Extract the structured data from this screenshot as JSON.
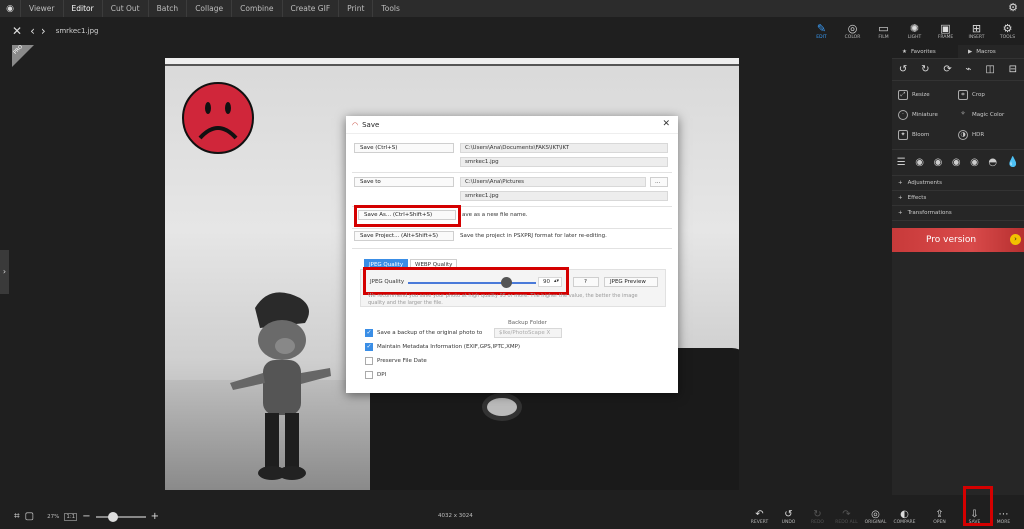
{
  "menu": {
    "items": [
      "Viewer",
      "Editor",
      "Cut Out",
      "Batch",
      "Collage",
      "Combine",
      "Create GIF",
      "Print",
      "Tools"
    ],
    "active": "Editor"
  },
  "file": {
    "name": "smrkec1.jpg"
  },
  "tools": [
    {
      "label": "EDIT",
      "glyph": "✎"
    },
    {
      "label": "COLOR",
      "glyph": "◎"
    },
    {
      "label": "FILM",
      "glyph": "▭"
    },
    {
      "label": "LIGHT",
      "glyph": "✺"
    },
    {
      "label": "FRAME",
      "glyph": "▣"
    },
    {
      "label": "INSERT",
      "glyph": "⊞"
    },
    {
      "label": "TOOLS",
      "glyph": "⚙"
    }
  ],
  "right_panel": {
    "tabs": [
      "Favorites",
      "Macros"
    ],
    "tool_items": [
      "Resize",
      "Crop",
      "Miniature",
      "Magic Color",
      "Bloom",
      "HDR"
    ],
    "sections": [
      "Adjustments",
      "Effects",
      "Transformations"
    ],
    "pro_banner": "Pro version"
  },
  "corner_badge": "PRO",
  "dialog": {
    "title": "Save",
    "save_label": "Save   (Ctrl+S)",
    "save_path": "C:\\Users\\Ana\\Documents\\FAKS\\IKT\\IKT",
    "save_file": "smrkec1.jpg",
    "save_to_label": "Save to",
    "save_to_path": "C:\\Users\\Ana\\Pictures",
    "save_to_browse": "...",
    "save_to_file": "smrkec1.jpg",
    "save_as_label": "Save As...   (Ctrl+Shift+S)",
    "save_as_desc": "ave as a new file name.",
    "save_project_label": "Save Project...   (Alt+Shift+S)",
    "save_project_desc": "Save the project in PSXPRJ format for later re-editing.",
    "tab_jpeg": "JPEG Quality",
    "tab_webp": "WEBP Quality",
    "jpeg_quality_label": "JPEG Quality",
    "jpeg_quality_value": "90",
    "jpeg_quality_fraction": 0.9,
    "help_button": "?",
    "preview_button": "JPEG Preview",
    "quality_note_1": "We recommend you save your photo at high quality 95 or more. The higher the value, the better the image",
    "quality_note_2": "quality and the larger the file.",
    "backup_folder_label": "Backup Folder",
    "backup_folder_value": "$Ike/PhotoScape X",
    "options": [
      {
        "label": "Save a backup of the original photo to",
        "checked": true
      },
      {
        "label": "Maintain Metadata Information (EXIF,GPS,IPTC,XMP)",
        "checked": true
      },
      {
        "label": "Preserve File Date",
        "checked": false
      },
      {
        "label": "DPI",
        "checked": false
      }
    ]
  },
  "bottom": {
    "zoom": "27%",
    "zoom_fit": "1:1",
    "zoom_fraction": 0.27,
    "image_size": "4032 x 3024",
    "actions": [
      {
        "label": "REVERT",
        "glyph": "↶",
        "enabled": true
      },
      {
        "label": "UNDO",
        "glyph": "↺",
        "enabled": true
      },
      {
        "label": "REDO",
        "glyph": "↻",
        "enabled": false
      },
      {
        "label": "REDO ALL",
        "glyph": "↷",
        "enabled": false
      },
      {
        "label": "ORIGINAL",
        "glyph": "◎",
        "enabled": true
      },
      {
        "label": "COMPARE",
        "glyph": "◐",
        "enabled": true
      },
      {
        "label": "OPEN",
        "glyph": "⇪",
        "enabled": true
      },
      {
        "label": "SAVE",
        "glyph": "⇩",
        "enabled": true
      },
      {
        "label": "MORE",
        "glyph": "⋯",
        "enabled": true
      }
    ]
  },
  "colors": {
    "accent": "#3aa0ff",
    "highlight": "#d40000",
    "panel": "#262626"
  }
}
